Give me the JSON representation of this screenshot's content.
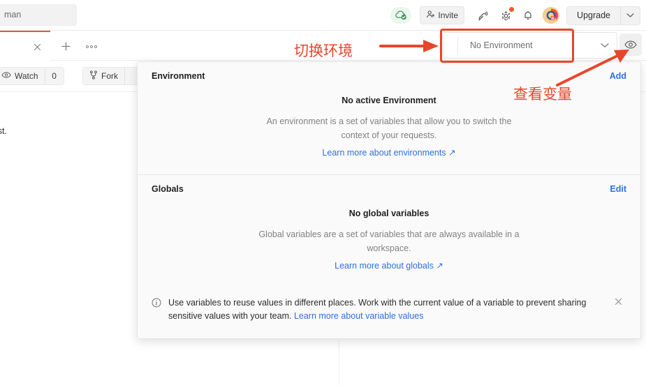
{
  "header": {
    "search_value": "man",
    "cloud_status_icon": "cloud-check-icon",
    "invite_label": "Invite",
    "invite_icon": "person-add-icon",
    "icons": [
      {
        "name": "satellite-antenna-icon"
      },
      {
        "name": "gear-icon"
      },
      {
        "name": "bell-icon"
      }
    ],
    "avatar_icon": "user-avatar",
    "upgrade_label": "Upgrade",
    "upgrade_caret_icon": "chevron-down-icon"
  },
  "tabbar": {
    "close_icon": "close-icon",
    "new_tab_icon": "plus-icon",
    "more_icon": "ellipsis-icon"
  },
  "environment_selector": {
    "value": "No Environment",
    "caret_icon": "chevron-down-icon",
    "eye_icon": "eye-icon"
  },
  "workspace": {
    "watch_label": "Watch",
    "watch_icon": "eye-icon",
    "watch_count": "0",
    "fork_label": "Fork",
    "fork_icon": "fork-icon",
    "description_text": "ying one in the request."
  },
  "env_panel": {
    "environment": {
      "section_title": "Environment",
      "action_label": "Add",
      "empty_title": "No active Environment",
      "empty_desc": "An environment is a set of variables that allow you to switch the context of your requests.",
      "empty_link": "Learn more about environments ↗"
    },
    "globals": {
      "section_title": "Globals",
      "action_label": "Edit",
      "empty_title": "No global variables",
      "empty_desc": "Global variables are a set of variables that are always available in a workspace.",
      "empty_link": "Learn more about globals ↗"
    },
    "footer": {
      "info_icon": "info-circle-icon",
      "text": "Use variables to reuse values in different places. Work with the current value of a variable to prevent sharing sensitive values with your team. ",
      "link": "Learn more about variable values",
      "close_icon": "close-icon"
    }
  },
  "annotations": {
    "switch_env": "切换环境",
    "view_vars": "查看变量",
    "color": "#e8462a"
  }
}
